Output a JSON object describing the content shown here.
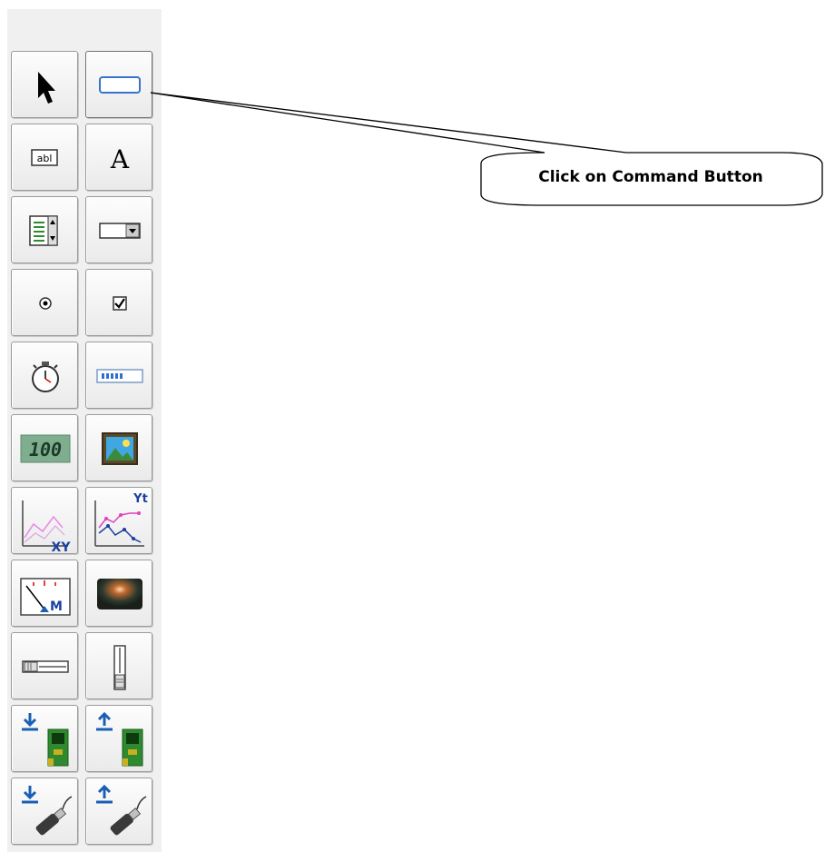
{
  "toolbox": {
    "tools": [
      {
        "name": "pointer",
        "icon": "pointer-arrow-icon"
      },
      {
        "name": "command-button",
        "icon": "command-button-icon"
      },
      {
        "name": "text-box",
        "icon": "text-box-icon"
      },
      {
        "name": "label",
        "icon": "label-text-icon"
      },
      {
        "name": "list-box",
        "icon": "list-box-icon"
      },
      {
        "name": "combo-box",
        "icon": "combo-box-icon"
      },
      {
        "name": "option-button",
        "icon": "radio-button-icon"
      },
      {
        "name": "check-box",
        "icon": "checkbox-icon"
      },
      {
        "name": "timer",
        "icon": "stopwatch-icon"
      },
      {
        "name": "progress-bar",
        "icon": "progress-bar-icon"
      },
      {
        "name": "lcd-display",
        "icon": "lcd-display-icon",
        "text": "100"
      },
      {
        "name": "image",
        "icon": "picture-icon"
      },
      {
        "name": "xy-graph",
        "icon": "xy-graph-icon",
        "text": "XY"
      },
      {
        "name": "yt-graph",
        "icon": "yt-graph-icon",
        "text": "Yt"
      },
      {
        "name": "meter",
        "icon": "meter-gauge-icon",
        "text": "M"
      },
      {
        "name": "led",
        "icon": "led-indicator-icon"
      },
      {
        "name": "horizontal-slider",
        "icon": "horizontal-slider-icon"
      },
      {
        "name": "vertical-slider",
        "icon": "vertical-slider-icon"
      },
      {
        "name": "digital-input",
        "icon": "board-download-icon"
      },
      {
        "name": "digital-output",
        "icon": "board-upload-icon"
      },
      {
        "name": "usb-input",
        "icon": "usb-download-icon"
      },
      {
        "name": "usb-output",
        "icon": "usb-upload-icon"
      }
    ]
  },
  "callout": {
    "text": "Click on Command Button"
  },
  "colors": {
    "panel_bg": "#f0f0f0",
    "accent_blue": "#1a5fb4",
    "lcd_green": "#7fae8f"
  }
}
